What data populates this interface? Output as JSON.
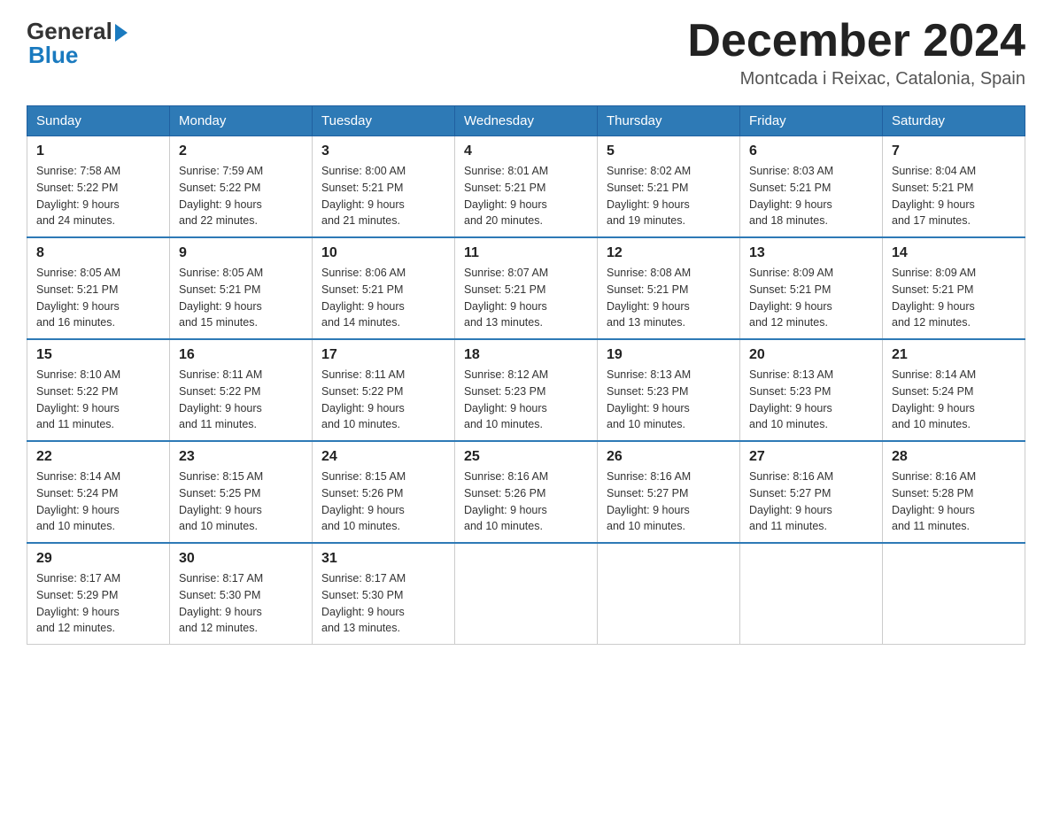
{
  "header": {
    "logo_general": "General",
    "logo_blue": "Blue",
    "month_title": "December 2024",
    "location": "Montcada i Reixac, Catalonia, Spain"
  },
  "days_of_week": [
    "Sunday",
    "Monday",
    "Tuesday",
    "Wednesday",
    "Thursday",
    "Friday",
    "Saturday"
  ],
  "weeks": [
    [
      {
        "day": "1",
        "sunrise": "7:58 AM",
        "sunset": "5:22 PM",
        "daylight": "9 hours and 24 minutes."
      },
      {
        "day": "2",
        "sunrise": "7:59 AM",
        "sunset": "5:22 PM",
        "daylight": "9 hours and 22 minutes."
      },
      {
        "day": "3",
        "sunrise": "8:00 AM",
        "sunset": "5:21 PM",
        "daylight": "9 hours and 21 minutes."
      },
      {
        "day": "4",
        "sunrise": "8:01 AM",
        "sunset": "5:21 PM",
        "daylight": "9 hours and 20 minutes."
      },
      {
        "day": "5",
        "sunrise": "8:02 AM",
        "sunset": "5:21 PM",
        "daylight": "9 hours and 19 minutes."
      },
      {
        "day": "6",
        "sunrise": "8:03 AM",
        "sunset": "5:21 PM",
        "daylight": "9 hours and 18 minutes."
      },
      {
        "day": "7",
        "sunrise": "8:04 AM",
        "sunset": "5:21 PM",
        "daylight": "9 hours and 17 minutes."
      }
    ],
    [
      {
        "day": "8",
        "sunrise": "8:05 AM",
        "sunset": "5:21 PM",
        "daylight": "9 hours and 16 minutes."
      },
      {
        "day": "9",
        "sunrise": "8:05 AM",
        "sunset": "5:21 PM",
        "daylight": "9 hours and 15 minutes."
      },
      {
        "day": "10",
        "sunrise": "8:06 AM",
        "sunset": "5:21 PM",
        "daylight": "9 hours and 14 minutes."
      },
      {
        "day": "11",
        "sunrise": "8:07 AM",
        "sunset": "5:21 PM",
        "daylight": "9 hours and 13 minutes."
      },
      {
        "day": "12",
        "sunrise": "8:08 AM",
        "sunset": "5:21 PM",
        "daylight": "9 hours and 13 minutes."
      },
      {
        "day": "13",
        "sunrise": "8:09 AM",
        "sunset": "5:21 PM",
        "daylight": "9 hours and 12 minutes."
      },
      {
        "day": "14",
        "sunrise": "8:09 AM",
        "sunset": "5:21 PM",
        "daylight": "9 hours and 12 minutes."
      }
    ],
    [
      {
        "day": "15",
        "sunrise": "8:10 AM",
        "sunset": "5:22 PM",
        "daylight": "9 hours and 11 minutes."
      },
      {
        "day": "16",
        "sunrise": "8:11 AM",
        "sunset": "5:22 PM",
        "daylight": "9 hours and 11 minutes."
      },
      {
        "day": "17",
        "sunrise": "8:11 AM",
        "sunset": "5:22 PM",
        "daylight": "9 hours and 10 minutes."
      },
      {
        "day": "18",
        "sunrise": "8:12 AM",
        "sunset": "5:23 PM",
        "daylight": "9 hours and 10 minutes."
      },
      {
        "day": "19",
        "sunrise": "8:13 AM",
        "sunset": "5:23 PM",
        "daylight": "9 hours and 10 minutes."
      },
      {
        "day": "20",
        "sunrise": "8:13 AM",
        "sunset": "5:23 PM",
        "daylight": "9 hours and 10 minutes."
      },
      {
        "day": "21",
        "sunrise": "8:14 AM",
        "sunset": "5:24 PM",
        "daylight": "9 hours and 10 minutes."
      }
    ],
    [
      {
        "day": "22",
        "sunrise": "8:14 AM",
        "sunset": "5:24 PM",
        "daylight": "9 hours and 10 minutes."
      },
      {
        "day": "23",
        "sunrise": "8:15 AM",
        "sunset": "5:25 PM",
        "daylight": "9 hours and 10 minutes."
      },
      {
        "day": "24",
        "sunrise": "8:15 AM",
        "sunset": "5:26 PM",
        "daylight": "9 hours and 10 minutes."
      },
      {
        "day": "25",
        "sunrise": "8:16 AM",
        "sunset": "5:26 PM",
        "daylight": "9 hours and 10 minutes."
      },
      {
        "day": "26",
        "sunrise": "8:16 AM",
        "sunset": "5:27 PM",
        "daylight": "9 hours and 10 minutes."
      },
      {
        "day": "27",
        "sunrise": "8:16 AM",
        "sunset": "5:27 PM",
        "daylight": "9 hours and 11 minutes."
      },
      {
        "day": "28",
        "sunrise": "8:16 AM",
        "sunset": "5:28 PM",
        "daylight": "9 hours and 11 minutes."
      }
    ],
    [
      {
        "day": "29",
        "sunrise": "8:17 AM",
        "sunset": "5:29 PM",
        "daylight": "9 hours and 12 minutes."
      },
      {
        "day": "30",
        "sunrise": "8:17 AM",
        "sunset": "5:30 PM",
        "daylight": "9 hours and 12 minutes."
      },
      {
        "day": "31",
        "sunrise": "8:17 AM",
        "sunset": "5:30 PM",
        "daylight": "9 hours and 13 minutes."
      },
      null,
      null,
      null,
      null
    ]
  ]
}
